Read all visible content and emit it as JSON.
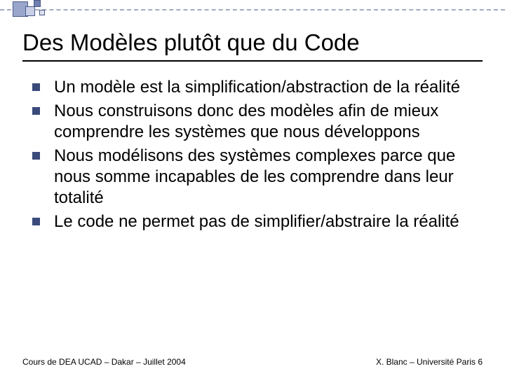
{
  "slide": {
    "title": "Des Modèles plutôt que du Code",
    "bullets": [
      "Un modèle est la simplification/abstraction de la réalité",
      "Nous construisons donc des modèles afin de mieux comprendre les systèmes que nous développons",
      "Nous modélisons des systèmes complexes parce que nous somme incapables de les comprendre dans leur totalité",
      "Le code ne permet pas de simplifier/abstraire la réalité"
    ],
    "footer_left": "Cours de DEA UCAD – Dakar – Juillet 2004",
    "footer_right": "X. Blanc – Université Paris 6"
  }
}
